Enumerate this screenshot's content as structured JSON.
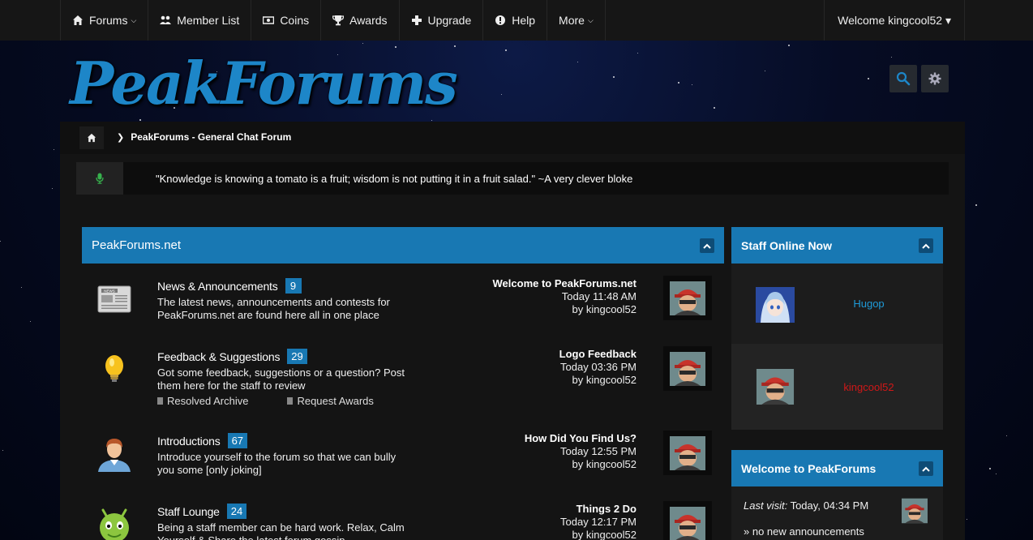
{
  "nav": {
    "items": [
      {
        "label": "Forums",
        "icon": "home-icon",
        "has_caret": true
      },
      {
        "label": "Member List",
        "icon": "users-icon",
        "has_caret": false
      },
      {
        "label": "Coins",
        "icon": "money-icon",
        "has_caret": false
      },
      {
        "label": "Awards",
        "icon": "trophy-icon",
        "has_caret": false
      },
      {
        "label": "Upgrade",
        "icon": "plus-icon",
        "has_caret": false
      },
      {
        "label": "Help",
        "icon": "info-icon",
        "has_caret": false
      },
      {
        "label": "More",
        "icon": "",
        "has_caret": true
      }
    ],
    "welcome": "Welcome kingcool52 ▾"
  },
  "header": {
    "logo_text": "PeakForums",
    "search_icon": "search-icon",
    "settings_icon": "gear-icon"
  },
  "breadcrumb": {
    "home_icon": "home-icon",
    "current": "PeakForums - General Chat Forum"
  },
  "notice": {
    "icon": "microphone-icon",
    "text": "\"Knowledge is knowing a tomato is a fruit; wisdom is not putting it in a fruit salad.\" ~A very clever bloke"
  },
  "forum": {
    "category": "PeakForums.net",
    "rows": [
      {
        "icon": "newspaper-icon",
        "title": "News & Announcements",
        "count": "9",
        "desc": "The latest news, announcements and contests for PeakForums.net are found here all in one place",
        "subforums": [],
        "last_title": "Welcome to PeakForums.net",
        "last_time": "Today 11:48 AM",
        "last_by": "by kingcool52"
      },
      {
        "icon": "lightbulb-icon",
        "title": "Feedback & Suggestions",
        "count": "29",
        "desc": "Got some feedback, suggestions or a question? Post them here for the staff to review",
        "subforums": [
          "Resolved Archive",
          "Request Awards"
        ],
        "last_title": "Logo Feedback",
        "last_time": "Today 03:36 PM",
        "last_by": "by kingcool52"
      },
      {
        "icon": "person-icon",
        "title": "Introductions",
        "count": "67",
        "desc": "Introduce yourself to the forum so that we can bully you some [only joking]",
        "subforums": [],
        "last_title": "How Did You Find Us?",
        "last_time": "Today 12:55 PM",
        "last_by": "by kingcool52"
      },
      {
        "icon": "android-icon",
        "title": "Staff Lounge",
        "count": "24",
        "desc": "Being a staff member can be hard work. Relax, Calm Yourself & Share the latest forum gossip",
        "subforums": [],
        "last_title": "Things 2 Do",
        "last_time": "Today 12:17 PM",
        "last_by": "by kingcool52"
      }
    ]
  },
  "sidebar": {
    "staff_title": "Staff Online Now",
    "staff": [
      {
        "name": "Hugop",
        "color": "#1e9ad8"
      },
      {
        "name": "kingcool52",
        "color": "#d01818"
      }
    ],
    "welcome_title": "Welcome to PeakForums",
    "last_visit_label": "Last visit:",
    "last_visit_value": "Today, 04:34 PM",
    "announcements": "» no new announcements"
  },
  "colors": {
    "accent": "#1878b3",
    "logo": "#1d86c8",
    "admin_name": "#d01818",
    "mod_name": "#1e9ad8"
  }
}
